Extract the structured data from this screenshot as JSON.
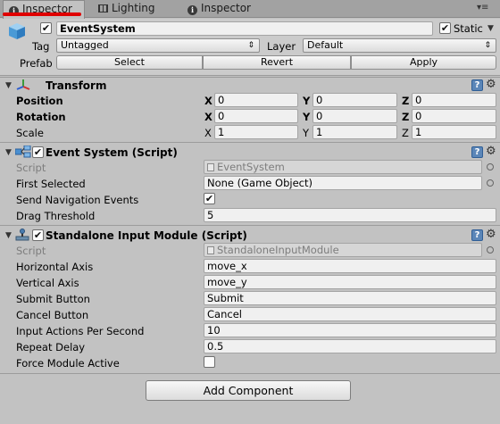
{
  "tabs": [
    {
      "label": "Inspector",
      "icon": "info-icon"
    },
    {
      "label": "Lighting",
      "icon": "lighting-grid-icon"
    },
    {
      "label": "Inspector",
      "icon": "info-icon"
    }
  ],
  "gameobject": {
    "active": true,
    "name": "EventSystem",
    "static_checked": true,
    "static_label": "Static",
    "tag_label": "Tag",
    "tag_value": "Untagged",
    "layer_label": "Layer",
    "layer_value": "Default",
    "prefab_label": "Prefab",
    "prefab_select": "Select",
    "prefab_revert": "Revert",
    "prefab_apply": "Apply"
  },
  "transform": {
    "title": "Transform",
    "rows": [
      {
        "label": "Position",
        "x": "0",
        "y": "0",
        "z": "0"
      },
      {
        "label": "Rotation",
        "x": "0",
        "y": "0",
        "z": "0"
      },
      {
        "label": "Scale",
        "x": "1",
        "y": "1",
        "z": "1"
      }
    ],
    "axis": {
      "x": "X",
      "y": "Y",
      "z": "Z"
    }
  },
  "event_system": {
    "enabled": true,
    "title": "Event System (Script)",
    "script_label": "Script",
    "script_value": "EventSystem",
    "first_selected_label": "First Selected",
    "first_selected_value": "None (Game Object)",
    "send_nav_label": "Send Navigation Events",
    "send_nav_checked": true,
    "drag_threshold_label": "Drag Threshold",
    "drag_threshold_value": "5"
  },
  "standalone": {
    "enabled": true,
    "title": "Standalone Input Module (Script)",
    "script_label": "Script",
    "script_value": "StandaloneInputModule",
    "fields": [
      {
        "label": "Horizontal Axis",
        "value": "move_x"
      },
      {
        "label": "Vertical Axis",
        "value": "move_y"
      },
      {
        "label": "Submit Button",
        "value": "Submit"
      },
      {
        "label": "Cancel Button",
        "value": "Cancel"
      },
      {
        "label": "Input Actions Per Second",
        "value": "10"
      },
      {
        "label": "Repeat Delay",
        "value": "0.5"
      }
    ],
    "force_label": "Force Module Active",
    "force_checked": false
  },
  "add_component_label": "Add Component",
  "colors": {
    "highlight": "#e00000",
    "help_icon": "#5b86b8"
  }
}
